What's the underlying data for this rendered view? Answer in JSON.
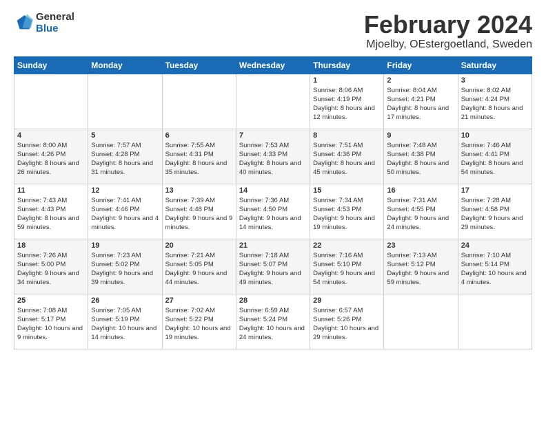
{
  "logo": {
    "text_general": "General",
    "text_blue": "Blue"
  },
  "header": {
    "month": "February 2024",
    "location": "Mjoelby, OEstergoetland, Sweden"
  },
  "weekdays": [
    "Sunday",
    "Monday",
    "Tuesday",
    "Wednesday",
    "Thursday",
    "Friday",
    "Saturday"
  ],
  "weeks": [
    [
      {
        "day": "",
        "info": ""
      },
      {
        "day": "",
        "info": ""
      },
      {
        "day": "",
        "info": ""
      },
      {
        "day": "",
        "info": ""
      },
      {
        "day": "1",
        "info": "Sunrise: 8:06 AM\nSunset: 4:19 PM\nDaylight: 8 hours\nand 12 minutes."
      },
      {
        "day": "2",
        "info": "Sunrise: 8:04 AM\nSunset: 4:21 PM\nDaylight: 8 hours\nand 17 minutes."
      },
      {
        "day": "3",
        "info": "Sunrise: 8:02 AM\nSunset: 4:24 PM\nDaylight: 8 hours\nand 21 minutes."
      }
    ],
    [
      {
        "day": "4",
        "info": "Sunrise: 8:00 AM\nSunset: 4:26 PM\nDaylight: 8 hours\nand 26 minutes."
      },
      {
        "day": "5",
        "info": "Sunrise: 7:57 AM\nSunset: 4:28 PM\nDaylight: 8 hours\nand 31 minutes."
      },
      {
        "day": "6",
        "info": "Sunrise: 7:55 AM\nSunset: 4:31 PM\nDaylight: 8 hours\nand 35 minutes."
      },
      {
        "day": "7",
        "info": "Sunrise: 7:53 AM\nSunset: 4:33 PM\nDaylight: 8 hours\nand 40 minutes."
      },
      {
        "day": "8",
        "info": "Sunrise: 7:51 AM\nSunset: 4:36 PM\nDaylight: 8 hours\nand 45 minutes."
      },
      {
        "day": "9",
        "info": "Sunrise: 7:48 AM\nSunset: 4:38 PM\nDaylight: 8 hours\nand 50 minutes."
      },
      {
        "day": "10",
        "info": "Sunrise: 7:46 AM\nSunset: 4:41 PM\nDaylight: 8 hours\nand 54 minutes."
      }
    ],
    [
      {
        "day": "11",
        "info": "Sunrise: 7:43 AM\nSunset: 4:43 PM\nDaylight: 8 hours\nand 59 minutes."
      },
      {
        "day": "12",
        "info": "Sunrise: 7:41 AM\nSunset: 4:46 PM\nDaylight: 9 hours\nand 4 minutes."
      },
      {
        "day": "13",
        "info": "Sunrise: 7:39 AM\nSunset: 4:48 PM\nDaylight: 9 hours\nand 9 minutes."
      },
      {
        "day": "14",
        "info": "Sunrise: 7:36 AM\nSunset: 4:50 PM\nDaylight: 9 hours\nand 14 minutes."
      },
      {
        "day": "15",
        "info": "Sunrise: 7:34 AM\nSunset: 4:53 PM\nDaylight: 9 hours\nand 19 minutes."
      },
      {
        "day": "16",
        "info": "Sunrise: 7:31 AM\nSunset: 4:55 PM\nDaylight: 9 hours\nand 24 minutes."
      },
      {
        "day": "17",
        "info": "Sunrise: 7:28 AM\nSunset: 4:58 PM\nDaylight: 9 hours\nand 29 minutes."
      }
    ],
    [
      {
        "day": "18",
        "info": "Sunrise: 7:26 AM\nSunset: 5:00 PM\nDaylight: 9 hours\nand 34 minutes."
      },
      {
        "day": "19",
        "info": "Sunrise: 7:23 AM\nSunset: 5:02 PM\nDaylight: 9 hours\nand 39 minutes."
      },
      {
        "day": "20",
        "info": "Sunrise: 7:21 AM\nSunset: 5:05 PM\nDaylight: 9 hours\nand 44 minutes."
      },
      {
        "day": "21",
        "info": "Sunrise: 7:18 AM\nSunset: 5:07 PM\nDaylight: 9 hours\nand 49 minutes."
      },
      {
        "day": "22",
        "info": "Sunrise: 7:16 AM\nSunset: 5:10 PM\nDaylight: 9 hours\nand 54 minutes."
      },
      {
        "day": "23",
        "info": "Sunrise: 7:13 AM\nSunset: 5:12 PM\nDaylight: 9 hours\nand 59 minutes."
      },
      {
        "day": "24",
        "info": "Sunrise: 7:10 AM\nSunset: 5:14 PM\nDaylight: 10 hours\nand 4 minutes."
      }
    ],
    [
      {
        "day": "25",
        "info": "Sunrise: 7:08 AM\nSunset: 5:17 PM\nDaylight: 10 hours\nand 9 minutes."
      },
      {
        "day": "26",
        "info": "Sunrise: 7:05 AM\nSunset: 5:19 PM\nDaylight: 10 hours\nand 14 minutes."
      },
      {
        "day": "27",
        "info": "Sunrise: 7:02 AM\nSunset: 5:22 PM\nDaylight: 10 hours\nand 19 minutes."
      },
      {
        "day": "28",
        "info": "Sunrise: 6:59 AM\nSunset: 5:24 PM\nDaylight: 10 hours\nand 24 minutes."
      },
      {
        "day": "29",
        "info": "Sunrise: 6:57 AM\nSunset: 5:26 PM\nDaylight: 10 hours\nand 29 minutes."
      },
      {
        "day": "",
        "info": ""
      },
      {
        "day": "",
        "info": ""
      }
    ]
  ]
}
